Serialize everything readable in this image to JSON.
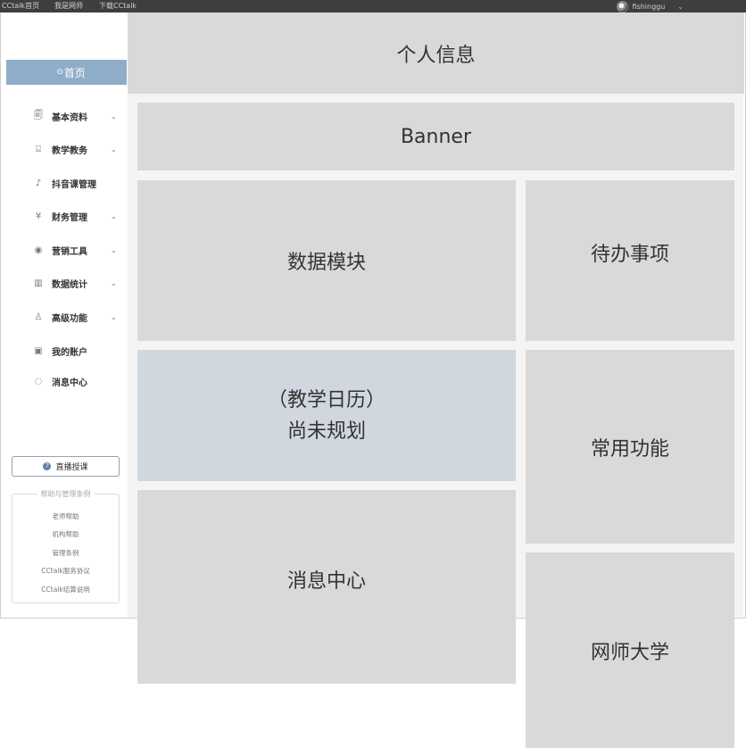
{
  "topbar": {
    "links": [
      "CCtalk首页",
      "我是网师",
      "下载CCtalk"
    ],
    "username": "fishinggu",
    "caret": "⌄"
  },
  "sidebar": {
    "home_label": "首页",
    "items": [
      {
        "label": "基本资料",
        "icon": "document-icon",
        "glyph": "🗐",
        "has_submenu": true
      },
      {
        "label": "教学教务",
        "icon": "whiteboard-icon",
        "glyph": "⌸",
        "has_submenu": true
      },
      {
        "label": "抖音课管理",
        "icon": "tiktok-icon",
        "glyph": "♪",
        "has_submenu": false
      },
      {
        "label": "财务管理",
        "icon": "money-icon",
        "glyph": "¥",
        "has_submenu": true
      },
      {
        "label": "营销工具",
        "icon": "broadcast-icon",
        "glyph": "◉",
        "has_submenu": true
      },
      {
        "label": "数据统计",
        "icon": "chart-icon",
        "glyph": "▥",
        "has_submenu": true
      },
      {
        "label": "高级功能",
        "icon": "bell-icon",
        "glyph": "♙",
        "has_submenu": true
      },
      {
        "label": "我的账户",
        "icon": "id-card-icon",
        "glyph": "▣",
        "has_submenu": false
      },
      {
        "label": "消息中心",
        "icon": "notification-icon",
        "glyph": "◌",
        "has_submenu": false
      }
    ],
    "chevron": "⌄",
    "live_button": "直播授课",
    "help_title": "帮助与管理条例",
    "help_links": [
      "老师帮助",
      "机构帮助",
      "管理条例",
      "CCtalk服务协议",
      "CCtalk结算说明"
    ]
  },
  "blocks": {
    "profile": "个人信息",
    "banner": "Banner",
    "data_module": "数据模块",
    "todo": "待办事项",
    "calendar_line1": "（教学日历）",
    "calendar_line2": "尚未规划",
    "common_functions": "常用功能",
    "messages": "消息中心",
    "university": "网师大学"
  },
  "colors": {
    "topbar": "#3e3e3e",
    "home_active": "#8fadc8",
    "block": "#d9d9d9",
    "calendar_block": "#d1d7de"
  }
}
